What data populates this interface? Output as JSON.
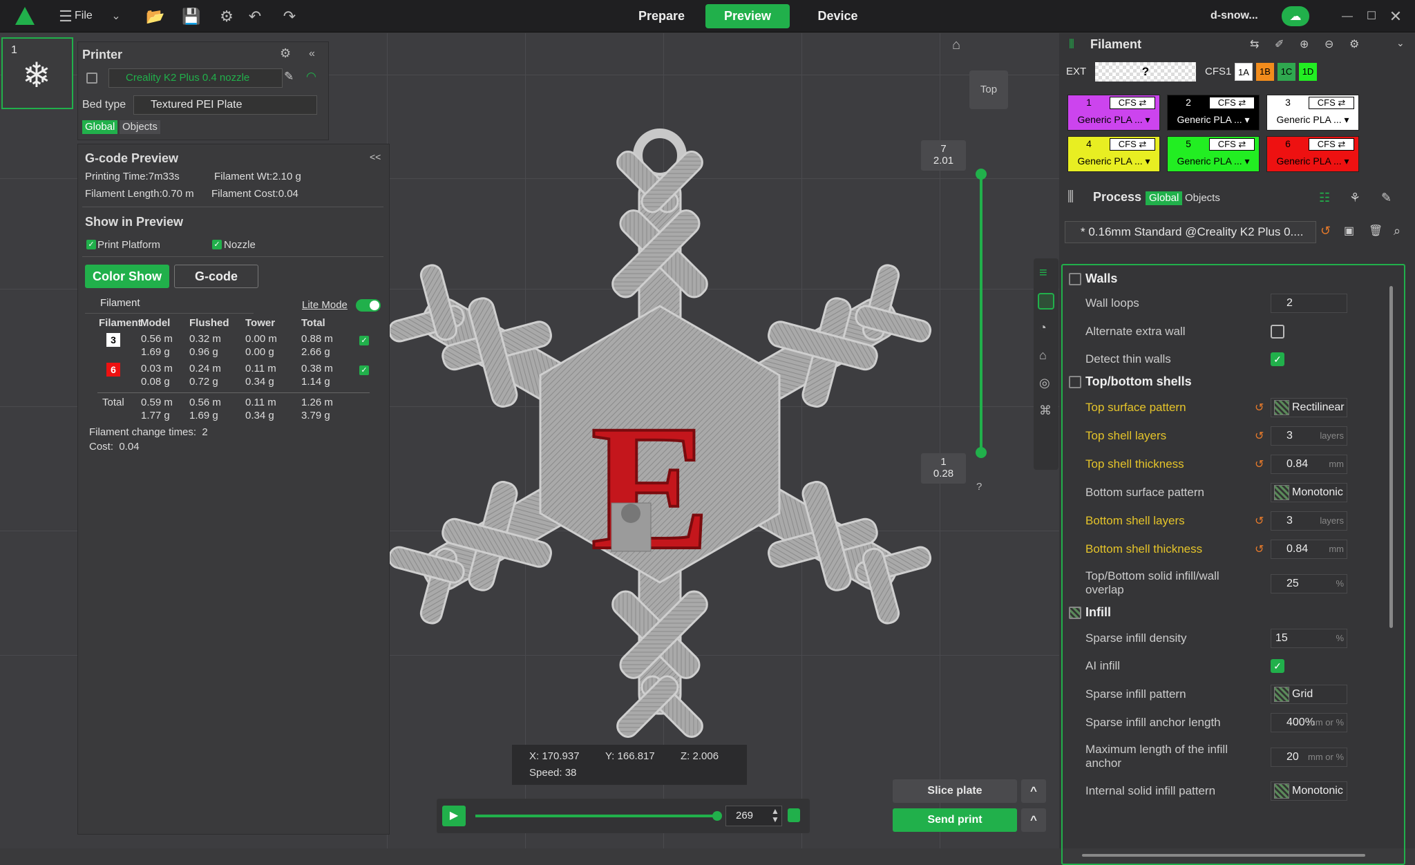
{
  "topbar": {
    "file_label": "File",
    "tabs": [
      "Prepare",
      "Preview",
      "Device"
    ],
    "active_tab": "Preview",
    "user": "d-snow..."
  },
  "thumbnail": {
    "index": "1"
  },
  "printer": {
    "title": "Printer",
    "name": "Creality K2 Plus 0.4 nozzle",
    "bed_type_label": "Bed type",
    "bed_type": "Textured PEI Plate",
    "scope": [
      "Global",
      "Objects"
    ]
  },
  "gcode": {
    "title": "G-code Preview",
    "collapse": "<<",
    "print_time": "Printing Time:7m33s",
    "filament_wt": "Filament Wt:2.10 g",
    "filament_len": "Filament Length:0.70 m",
    "filament_cost": "Filament Cost:0.04",
    "show_title": "Show in Preview",
    "print_platform": "Print Platform",
    "nozzle": "Nozzle",
    "color_show": "Color Show",
    "gcode_btn": "G-code",
    "filament_group": "Filament",
    "lite_mode": "Lite Mode",
    "headers": [
      "Filament",
      "Model",
      "Flushed",
      "Tower",
      "Total"
    ],
    "rows": [
      {
        "id": "3",
        "model_len": "0.56 m",
        "model_wt": "1.69 g",
        "flushed_len": "0.32 m",
        "flushed_wt": "0.96 g",
        "tower_len": "0.00 m",
        "tower_wt": "0.00 g",
        "total_len": "0.88 m",
        "total_wt": "2.66 g"
      },
      {
        "id": "6",
        "model_len": "0.03 m",
        "model_wt": "0.08 g",
        "flushed_len": "0.24 m",
        "flushed_wt": "0.72 g",
        "tower_len": "0.11 m",
        "tower_wt": "0.34 g",
        "total_len": "0.38 m",
        "total_wt": "1.14 g"
      }
    ],
    "total": {
      "label": "Total",
      "model_len": "0.59 m",
      "model_wt": "1.77 g",
      "flushed_len": "0.56 m",
      "flushed_wt": "1.69 g",
      "tower_len": "0.11 m",
      "tower_wt": "0.34 g",
      "total_len": "1.26 m",
      "total_wt": "3.79 g"
    },
    "change_times": "Filament change times:  2",
    "cost": "Cost:  0.04"
  },
  "view": {
    "top_label": "Top",
    "layer_top": "7",
    "layer_top_h": "2.01",
    "layer_bot": "1",
    "layer_bot_h": "0.28",
    "help": "?",
    "x": "X: 170.937",
    "y": "Y: 166.817",
    "z": "Z: 2.006",
    "speed": "Speed: 38",
    "model_letter": "E",
    "move_value": "269"
  },
  "actions": {
    "slice": "Slice plate",
    "send": "Send print",
    "arrow": "^"
  },
  "filament": {
    "title": "Filament",
    "ext": "EXT",
    "ext_value": "?",
    "cfs1": "CFS1",
    "slots": [
      "1A",
      "1B",
      "1C",
      "1D"
    ],
    "boxes": [
      {
        "n": "1",
        "cfs": "CFS ⇄",
        "name": "Generic PLA ... ▾",
        "color": "#cc44ee"
      },
      {
        "n": "2",
        "cfs": "CFS ⇄",
        "name": "Generic PLA ... ▾",
        "color": "#000000"
      },
      {
        "n": "3",
        "cfs": "CFS ⇄",
        "name": "Generic PLA ... ▾",
        "color": "#ffffff"
      },
      {
        "n": "4",
        "cfs": "CFS ⇄",
        "name": "Generic PLA ... ▾",
        "color": "#e8ee22"
      },
      {
        "n": "5",
        "cfs": "CFS ⇄",
        "name": "Generic PLA ... ▾",
        "color": "#22ee22"
      },
      {
        "n": "6",
        "cfs": "CFS ⇄",
        "name": "Generic PLA ... ▾",
        "color": "#ee1111"
      }
    ]
  },
  "process": {
    "title": "Process",
    "scope": [
      "Global",
      "Objects"
    ],
    "preset": "* 0.16mm Standard @Creality K2 Plus 0....",
    "sections": {
      "walls": "Walls",
      "shells": "Top/bottom shells",
      "infill": "Infill"
    },
    "wall_loops": {
      "label": "Wall loops",
      "value": "2"
    },
    "alt_wall": {
      "label": "Alternate extra wall"
    },
    "thin_walls": {
      "label": "Detect thin walls"
    },
    "top_pattern": {
      "label": "Top surface pattern",
      "value": "Rectilinear"
    },
    "top_layers": {
      "label": "Top shell layers",
      "value": "3",
      "unit": "layers"
    },
    "top_thick": {
      "label": "Top shell thickness",
      "value": "0.84",
      "unit": "mm"
    },
    "bot_pattern": {
      "label": "Bottom surface pattern",
      "value": "Monotonic"
    },
    "bot_layers": {
      "label": "Bottom shell layers",
      "value": "3",
      "unit": "layers"
    },
    "bot_thick": {
      "label": "Bottom shell thickness",
      "value": "0.84",
      "unit": "mm"
    },
    "overlap": {
      "label1": "Top/Bottom solid infill/wall",
      "label2": "overlap",
      "value": "25",
      "unit": "%"
    },
    "density": {
      "label": "Sparse infill density",
      "value": "15",
      "unit": "%"
    },
    "ai_infill": {
      "label": "AI infill"
    },
    "sparse_pattern": {
      "label": "Sparse infill pattern",
      "value": "Grid"
    },
    "anchor": {
      "label": "Sparse infill anchor length",
      "value": "400%",
      "unit": "mm or %"
    },
    "max_anchor": {
      "label1": "Maximum length of the infill",
      "label2": "anchor",
      "value": "20",
      "unit": "mm or %"
    },
    "internal": {
      "label": "Internal solid infill pattern",
      "value": "Monotonic"
    }
  }
}
